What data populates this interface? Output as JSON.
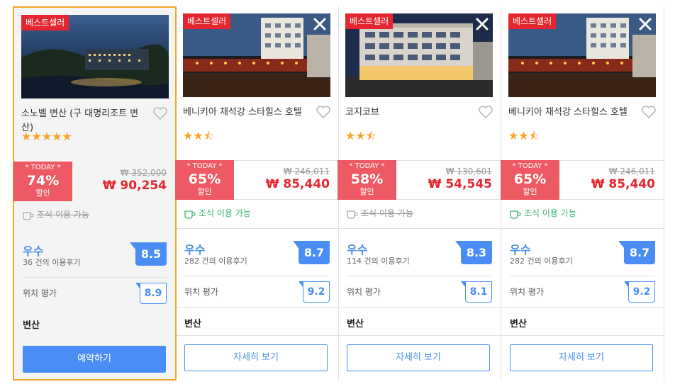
{
  "hotels": [
    {
      "badge": "베스트셀러",
      "name": "소노벨 변산 (구 대명리조트 변산)",
      "stars": 5,
      "today_label": "* TODAY *",
      "discount": "74%",
      "discount_label": "할인",
      "original_price": "₩ 352,000",
      "price": "₩ 90,254",
      "breakfast": "조식 이용 가능",
      "breakfast_available": false,
      "grade": "우수",
      "reviews": "36 건의 이용후기",
      "score": "8.5",
      "location_label": "위치 평가",
      "location_score": "8.9",
      "area": "변산",
      "button": "예약하기"
    },
    {
      "badge": "베스트셀러",
      "name": "베니키아 채석강 스타힐스 호텔",
      "stars": 2.5,
      "today_label": "* TODAY *",
      "discount": "65%",
      "discount_label": "할인",
      "original_price": "₩ 246,011",
      "price": "₩ 85,440",
      "breakfast": "조식 이용 가능",
      "breakfast_available": true,
      "grade": "우수",
      "reviews": "282 건의 이용후기",
      "score": "8.7",
      "location_label": "위치 평가",
      "location_score": "9.2",
      "area": "변산",
      "button": "자세히 보기"
    },
    {
      "badge": "베스트셀러",
      "name": "코지코브",
      "stars": 2.5,
      "today_label": "* TODAY *",
      "discount": "58%",
      "discount_label": "할인",
      "original_price": "₩ 130,601",
      "price": "₩ 54,545",
      "breakfast": "조식 이용 가능",
      "breakfast_available": false,
      "grade": "우수",
      "reviews": "114 건의 이용후기",
      "score": "8.3",
      "location_label": "위치 평가",
      "location_score": "8.1",
      "area": "변산",
      "button": "자세히 보기"
    },
    {
      "badge": "베스트셀러",
      "name": "베니키아 채석강 스타힐스 호텔",
      "stars": 2.5,
      "today_label": "* TODAY *",
      "discount": "65%",
      "discount_label": "할인",
      "original_price": "₩ 246,011",
      "price": "₩ 85,440",
      "breakfast": "조식 이용 가능",
      "breakfast_available": true,
      "grade": "우수",
      "reviews": "282 건의 이용후기",
      "score": "8.7",
      "location_label": "위치 평가",
      "location_score": "9.2",
      "area": "변산",
      "button": "자세히 보기"
    }
  ],
  "colors": {
    "accent_blue": "#4a8ef5",
    "discount_red": "#ee5a63",
    "price_red": "#e3262f",
    "badge_red": "#e3262f",
    "star_orange": "#f5a623",
    "selected_border": "#f5a623",
    "breakfast_green": "#3cb371"
  },
  "icons": {
    "favorite": "heart-outline-icon",
    "remove": "close-icon",
    "breakfast": "coffee-cup-icon"
  }
}
